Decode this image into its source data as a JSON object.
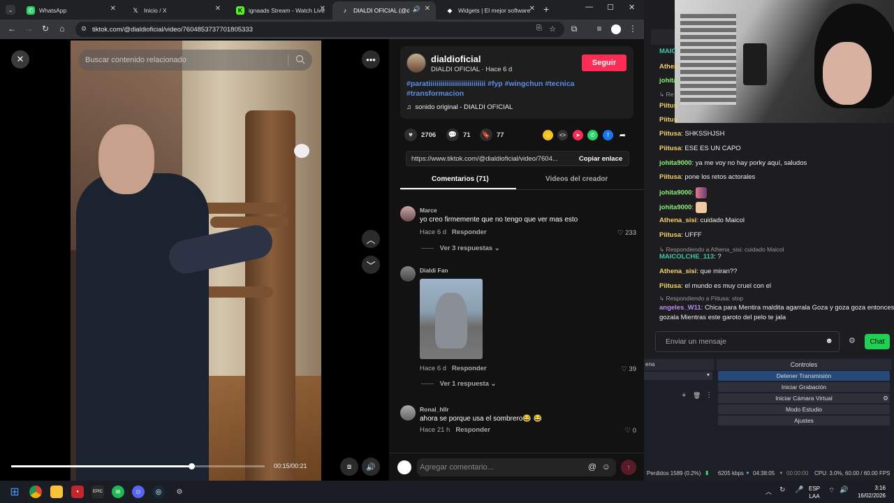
{
  "tabs": [
    {
      "label": "WhatsApp",
      "icon": "whatsapp-icon",
      "color": "#25d366"
    },
    {
      "label": "Inicio / X",
      "icon": "x-icon",
      "color": "#ffffff"
    },
    {
      "label": "ignaads Stream - Watch Live",
      "icon": "kick-icon",
      "color": "#53fc18"
    },
    {
      "label": "DIALDI OFICIAL (@dialdi",
      "icon": "tiktok-icon",
      "color": "#ffffff"
    },
    {
      "label": "Widgets | El mejor software",
      "icon": "streamelements-icon",
      "color": "#ffffff"
    }
  ],
  "address_bar": {
    "url": "tiktok.com/@dialdioficial/video/7604853737701805333"
  },
  "video": {
    "search_placeholder": "Buscar contenido relacionado",
    "time": "00:15/00:21",
    "progress": 0.71
  },
  "author": {
    "name": "dialdioficial",
    "subtitle": "DIALDI OFICIAL · Hace 6 d",
    "follow_label": "Seguir",
    "caption": "#paratiiiiiiiiiiiiiiiiiiiiiiiiiiii #fyp #wingchun #tecnica #transformacion",
    "sound": "sonido original - DIALDI OFICIAL"
  },
  "stats": {
    "likes": "2706",
    "comments": "71",
    "saves": "77"
  },
  "share": {
    "link": "https://www.tiktok.com/@dialdioficial/video/7604...",
    "copy_label": "Copiar enlace"
  },
  "panel_tabs": {
    "comments": "Comentarios (71)",
    "creator": "Videos del creador"
  },
  "comments": [
    {
      "user": "Marce",
      "text": "yo creo firmemente que no tengo que ver mas esto",
      "time": "Hace 6 d",
      "reply": "Responder",
      "likes": "233",
      "replies": "Ver 3 respuestas"
    },
    {
      "user": "Dialdi Fan",
      "text": "",
      "time": "Hace 6 d",
      "reply": "Responder",
      "likes": "39",
      "replies": "Ver 1 respuesta"
    },
    {
      "user": "Ronal_hllr",
      "text": "ahora se porque usa el sombrero😂 😂",
      "time": "Hace 21 h",
      "reply": "Responder",
      "likes": "0",
      "replies": ""
    }
  ],
  "add_comment_placeholder": "Agregar comentario...",
  "chat": {
    "lines": [
      {
        "user": "MAIC",
        "text": "",
        "color": "#3ec8a8"
      },
      {
        "user": "Athen",
        "text": "",
        "color": "#f4d35e"
      },
      {
        "user": "johita",
        "text": "",
        "color": "#8cf07a"
      },
      {
        "hint": "↳ Re"
      },
      {
        "user": "Piitus",
        "text": "",
        "color": "#f4d35e"
      },
      {
        "user": "Piitus",
        "text": "",
        "color": "#f4d35e"
      },
      {
        "user": "Piitusa",
        "text": ": SHKSSHJSH",
        "color": "#f4d35e"
      },
      {
        "user": "Piitusa",
        "text": ": ESE ES UN CAPO",
        "color": "#f4d35e"
      },
      {
        "user": "johita9000",
        "text": ": ya me voy no hay porky aquí, saludos",
        "color": "#8cf07a"
      },
      {
        "user": "Piitusa",
        "text": ": pone los retos actorales",
        "color": "#f4d35e"
      },
      {
        "user": "johita9000",
        "text": ":",
        "color": "#8cf07a",
        "emote": true
      },
      {
        "user": "johita9000",
        "text": ":",
        "color": "#8cf07a",
        "emote": true
      },
      {
        "user": "Athena_sisi",
        "text": ": cuidado Maicol",
        "color": "#f4d35e"
      },
      {
        "user": "Piitusa",
        "text": ": UFFF",
        "color": "#f4d35e"
      },
      {
        "hint": "↳ Respondiendo a Athena_sisi: cuidado Maicol"
      },
      {
        "user": "MAICOLCHE_113",
        "text": ": ?",
        "color": "#3ec8a8"
      },
      {
        "user": "Athena_sisi",
        "text": ": que miran??",
        "color": "#f4d35e"
      },
      {
        "user": "Piitusa",
        "text": ": el mundo es muy cruel con el",
        "color": "#f4d35e"
      },
      {
        "hint": "↳ Respondiendo a Piitusa: stop"
      },
      {
        "user": "angeles_W11",
        "text": ": Chica para Mentira maldita agarrala Goza y goza goza entonces",
        "color": "#b98cf0"
      },
      {
        "text_only": "gozala Mientras este garoto del pelo te jala"
      }
    ],
    "input_placeholder": "Enviar un mensaje",
    "send_label": "Chat"
  },
  "obs": {
    "panel_left": "ena",
    "controls_title": "Controles",
    "buttons": [
      "Detener Transmisión",
      "Iniciar Grabación",
      "Iniciar Cámara Virtual",
      "Modo Estudio",
      "Ajustes"
    ],
    "status": {
      "dropped": "Perdidos 1589 (0.2%)",
      "bitrate": "6205 kbps",
      "live": "04:38:05",
      "rec": "00:00:00",
      "cpu": "CPU: 3.0%, 60.00 / 60.00 FPS"
    }
  },
  "taskbar": {
    "lang": "ESP",
    "lang2": "LAA",
    "time": "3:16",
    "date": "16/02/2026"
  }
}
